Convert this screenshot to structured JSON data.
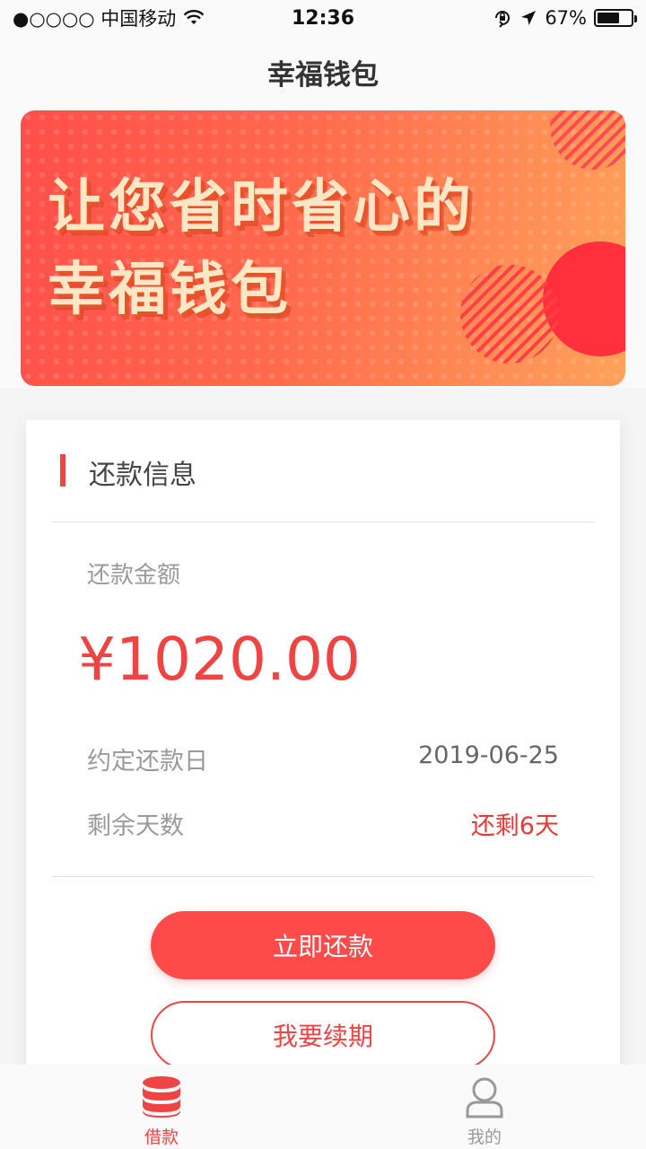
{
  "status_bar": {
    "carrier": "●○○○○ 中国移动",
    "time": "12:36",
    "battery": "67%",
    "battery_level": 0.67,
    "icons": [
      "wifi-icon",
      "orientation-lock-icon",
      "location-arrow-icon",
      "battery-icon"
    ]
  },
  "nav": {
    "title": "幸福钱包"
  },
  "banner": {
    "line1": "让您省时省心的",
    "line2": "幸福钱包"
  },
  "card": {
    "section_title": "还款信息",
    "amount_label": "还款金额",
    "amount": "¥1020.00",
    "due_date_label": "约定还款日",
    "due_date": "2019-06-25",
    "remaining_label": "剩余天数",
    "remaining": "还剩6天",
    "pay_button": "立即还款",
    "renew_button": "我要续期"
  },
  "tabs": [
    {
      "label": "借款",
      "icon": "database-icon",
      "active": true
    },
    {
      "label": "我的",
      "icon": "user-icon",
      "active": false
    }
  ],
  "colors": {
    "accent": "#ef4444",
    "button": "#ff4a4a",
    "inactive": "#999999"
  }
}
